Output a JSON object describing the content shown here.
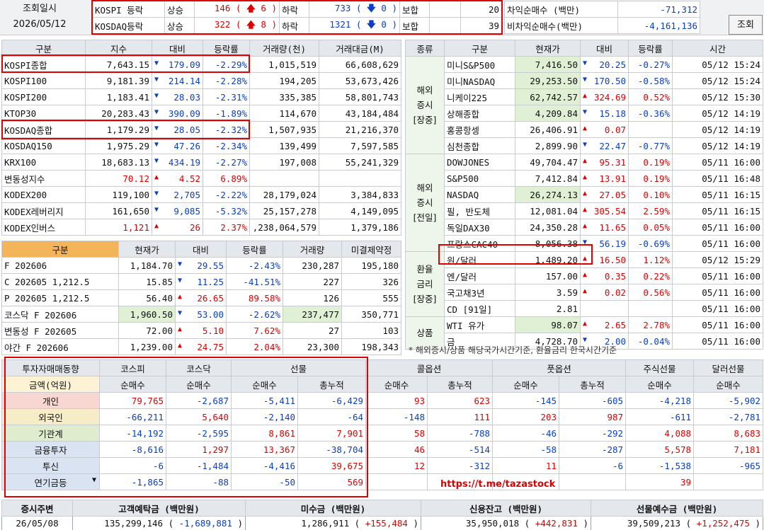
{
  "top": {
    "date_label": "조회일시",
    "date_value": "2026/05/12",
    "kospi": {
      "name": "KOSPI 등락",
      "up_label": "상승",
      "up_total": "146",
      "up_limit": "6",
      "down_label": "하락",
      "down_total": "733",
      "down_limit": "0",
      "flat_label": "보합",
      "flat": "20"
    },
    "kosdaq": {
      "name": "KOSDAQ등락",
      "up_label": "상승",
      "up_total": "322",
      "up_limit": "8",
      "down_label": "하락",
      "down_total": "1321",
      "down_limit": "0",
      "flat_label": "보합",
      "flat": "39"
    },
    "arb_label": "차익순매수 (백만)",
    "arb_value": "-71,312",
    "nonarb_label": "비차익순매수(백만)",
    "nonarb_value": "-4,161,136",
    "query_button": "조회"
  },
  "index_table": {
    "headers": [
      "구분",
      "지수",
      "대비",
      "등락률",
      "거래량(천)",
      "거래대금(M)"
    ],
    "rows": [
      {
        "name": "KOSPI종합",
        "value": "7,643.15",
        "dir": "dn",
        "chg": "179.09",
        "rate": "-2.29%",
        "vol": "1,015,519",
        "amt": "66,608,629"
      },
      {
        "name": "KOSPI100",
        "value": "9,181.39",
        "dir": "dn",
        "chg": "214.14",
        "rate": "-2.28%",
        "vol": "194,205",
        "amt": "53,673,426"
      },
      {
        "name": "KOSPI200",
        "value": "1,183.41",
        "dir": "dn",
        "chg": "28.03",
        "rate": "-2.31%",
        "vol": "335,385",
        "amt": "58,801,743"
      },
      {
        "name": "KTOP30",
        "value": "20,283.43",
        "dir": "dn",
        "chg": "390.09",
        "rate": "-1.89%",
        "vol": "114,670",
        "amt": "43,184,484"
      },
      {
        "name": "KOSDAQ종합",
        "value": "1,179.29",
        "dir": "dn",
        "chg": "28.05",
        "rate": "-2.32%",
        "vol": "1,507,935",
        "amt": "21,216,370"
      },
      {
        "name": "KOSDAQ150",
        "value": "1,975.29",
        "dir": "dn",
        "chg": "47.26",
        "rate": "-2.34%",
        "vol": "139,499",
        "amt": "7,597,585"
      },
      {
        "name": "KRX100",
        "value": "18,683.13",
        "dir": "dn",
        "chg": "434.19",
        "rate": "-2.27%",
        "vol": "197,008",
        "amt": "55,241,329"
      },
      {
        "name": "변동성지수",
        "value": "70.12",
        "dir": "up",
        "chg": "4.52",
        "rate": "6.89%",
        "vol": "",
        "amt": ""
      },
      {
        "name": "KODEX200",
        "value": "119,100",
        "dir": "dn",
        "chg": "2,705",
        "rate": "-2.22%",
        "vol": "28,179,024",
        "amt": "3,384,833"
      },
      {
        "name": "KODEX레버리지",
        "value": "161,650",
        "dir": "dn",
        "chg": "9,085",
        "rate": "-5.32%",
        "vol": "25,157,278",
        "amt": "4,149,095"
      },
      {
        "name": "KODEX인버스",
        "value": "1,121",
        "dir": "up",
        "chg": "26",
        "rate": "2.37%",
        "vol": ",238,064,579",
        "amt": "1,379,186"
      }
    ]
  },
  "futures_table": {
    "headers": [
      "구분",
      "현재가",
      "대비",
      "등락률",
      "거래량",
      "미결제약정"
    ],
    "rows": [
      {
        "name": "F 202606",
        "value": "1,184.70",
        "dir": "dn",
        "chg": "29.55",
        "rate": "-2.43%",
        "vol": "230,287",
        "oi": "195,180"
      },
      {
        "name": "C 202605 1,212.5",
        "value": "15.85",
        "dir": "dn",
        "chg": "11.25",
        "rate": "-41.51%",
        "vol": "227",
        "oi": "326"
      },
      {
        "name": "P 202605 1,212.5",
        "value": "56.40",
        "dir": "up",
        "chg": "26.65",
        "rate": "89.58%",
        "vol": "126",
        "oi": "555"
      },
      {
        "name": "코스닥 F 202606",
        "value": "1,960.50",
        "dir": "dn",
        "chg": "53.00",
        "rate": "-2.62%",
        "vol": "237,477",
        "oi": "350,771"
      },
      {
        "name": "변동성 F 202605",
        "value": "72.00",
        "dir": "up",
        "chg": "5.10",
        "rate": "7.62%",
        "vol": "27",
        "oi": "103"
      },
      {
        "name": "야간 F 202606",
        "value": "1,239.00",
        "dir": "up",
        "chg": "24.75",
        "rate": "2.04%",
        "vol": "23,300",
        "oi": "198,343"
      }
    ]
  },
  "world_table": {
    "headers": [
      "종류",
      "구분",
      "현재가",
      "대비",
      "등락률",
      "시간"
    ],
    "groups": [
      {
        "label": "해외\n증시\n[장중]",
        "rows": [
          {
            "name": "미니S&P500",
            "value": "7,416.50",
            "dir": "dn",
            "chg": "20.25",
            "rate": "-0.27%",
            "time": "05/12 15:24"
          },
          {
            "name": "미니NASDAQ",
            "value": "29,253.50",
            "dir": "dn",
            "chg": "170.50",
            "rate": "-0.58%",
            "time": "05/12 15:24"
          },
          {
            "name": "니케이225",
            "value": "62,742.57",
            "dir": "up",
            "chg": "324.69",
            "rate": "0.52%",
            "time": "05/12 15:30"
          },
          {
            "name": "상해종합",
            "value": "4,209.84",
            "dir": "dn",
            "chg": "15.18",
            "rate": "-0.36%",
            "time": "05/12 14:19"
          },
          {
            "name": "홍콩항셍",
            "value": "26,406.91",
            "dir": "up",
            "chg": "0.07",
            "rate": "",
            "time": "05/12 14:19"
          },
          {
            "name": "심천종합",
            "value": "2,899.90",
            "dir": "dn",
            "chg": "22.47",
            "rate": "-0.77%",
            "time": "05/12 14:19"
          }
        ]
      },
      {
        "label": "해외\n증시\n[전일]",
        "rows": [
          {
            "name": "DOWJONES",
            "value": "49,704.47",
            "dir": "up",
            "chg": "95.31",
            "rate": "0.19%",
            "time": "05/11 16:00"
          },
          {
            "name": "S&P500",
            "value": "7,412.84",
            "dir": "up",
            "chg": "13.91",
            "rate": "0.19%",
            "time": "05/11 16:48"
          },
          {
            "name": "NASDAQ",
            "value": "26,274.13",
            "dir": "up",
            "chg": "27.05",
            "rate": "0.10%",
            "time": "05/11 16:15"
          },
          {
            "name": "필, 반도체",
            "value": "12,081.04",
            "dir": "up",
            "chg": "305.54",
            "rate": "2.59%",
            "time": "05/11 16:15"
          },
          {
            "name": "독일DAX30",
            "value": "24,350.28",
            "dir": "up",
            "chg": "11.65",
            "rate": "0.05%",
            "time": "05/11 16:00"
          },
          {
            "name": "프랑스CAC40",
            "value": "8,056.38",
            "dir": "dn",
            "chg": "56.19",
            "rate": "-0.69%",
            "time": "05/11 16:00"
          }
        ]
      },
      {
        "label": "환율\n금리\n[장중]",
        "rows": [
          {
            "name": "원/달러",
            "value": "1,489.20",
            "dir": "up",
            "chg": "16.50",
            "rate": "1.12%",
            "time": "05/12 15:29"
          },
          {
            "name": "엔/달러",
            "value": "157.00",
            "dir": "up",
            "chg": "0.35",
            "rate": "0.22%",
            "time": "05/11 16:00"
          },
          {
            "name": "국고채3년",
            "value": "3.59",
            "dir": "up",
            "chg": "0.02",
            "rate": "0.56%",
            "time": "05/11 16:00"
          },
          {
            "name": "CD [91일]",
            "value": "2.81",
            "dir": "",
            "chg": "",
            "rate": "",
            "time": "05/11 16:00"
          }
        ]
      },
      {
        "label": "상품",
        "rows": [
          {
            "name": "WTI 유가",
            "value": "98.07",
            "dir": "up",
            "chg": "2.65",
            "rate": "2.78%",
            "time": "05/11 16:00"
          },
          {
            "name": "금",
            "value": "4,728.70",
            "dir": "dn",
            "chg": "2.00",
            "rate": "-0.04%",
            "time": "05/11 16:00"
          }
        ]
      }
    ],
    "note": "* 해외증시/상품 해당국가시간기준, 환율금리 한국시간기준"
  },
  "investor_table": {
    "title": "투자자매매동향",
    "unit": "금액(억원)",
    "top_headers": [
      "코스피",
      "코스닥",
      "선물",
      "콜옵션",
      "풋옵션",
      "주식선물",
      "달러선물"
    ],
    "sub_headers": [
      "순매수",
      "순매수",
      "순매수",
      "총누적",
      "순매수",
      "총누적",
      "순매수",
      "총누적",
      "순매수",
      "순매수"
    ],
    "rows": [
      {
        "name": "개인",
        "vals": [
          "79,765",
          "-2,687",
          "-5,411",
          "-6,429",
          "93",
          "623",
          "-145",
          "-605",
          "-4,218",
          "-5,902"
        ]
      },
      {
        "name": "외국인",
        "vals": [
          "-66,211",
          "5,640",
          "-2,140",
          "-64",
          "-148",
          "111",
          "203",
          "987",
          "-611",
          "-2,781"
        ]
      },
      {
        "name": "기관계",
        "vals": [
          "-14,192",
          "-2,595",
          "8,861",
          "7,901",
          "58",
          "-788",
          "-46",
          "-292",
          "4,088",
          "8,683"
        ]
      },
      {
        "name": "금융투자",
        "vals": [
          "-8,616",
          "1,297",
          "13,367",
          "-38,704",
          "46",
          "-514",
          "-58",
          "-287",
          "5,578",
          "7,181"
        ]
      },
      {
        "name": "투신",
        "vals": [
          "-6",
          "-1,484",
          "-4,416",
          "39,675",
          "12",
          "-312",
          "11",
          "-6",
          "-1,538",
          "-965"
        ]
      },
      {
        "name": "연기금등",
        "vals": [
          "-1,865",
          "-88",
          "-50",
          "569",
          "",
          "",
          "",
          "",
          "39",
          ""
        ]
      }
    ],
    "watermark": "https://t.me/tazastock"
  },
  "bottom": {
    "headers": [
      "증시주변",
      "고객예탁금 (백만원)",
      "미수금 (백만원)",
      "신용잔고 (백만원)",
      "선물예수금 (백만원)"
    ],
    "date": "26/05/08",
    "deposit": "135,299,146",
    "deposit_chg": "-1,689,881",
    "unpaid": "1,286,911",
    "unpaid_chg": "+155,484",
    "credit": "35,950,018",
    "credit_chg": "+442,831",
    "fut_dep": "39,509,213",
    "fut_dep_chg": "+1,252,475"
  },
  "colors": {
    "up": "#e00000",
    "down": "#0a3ec8",
    "highlight": "#e00000"
  }
}
